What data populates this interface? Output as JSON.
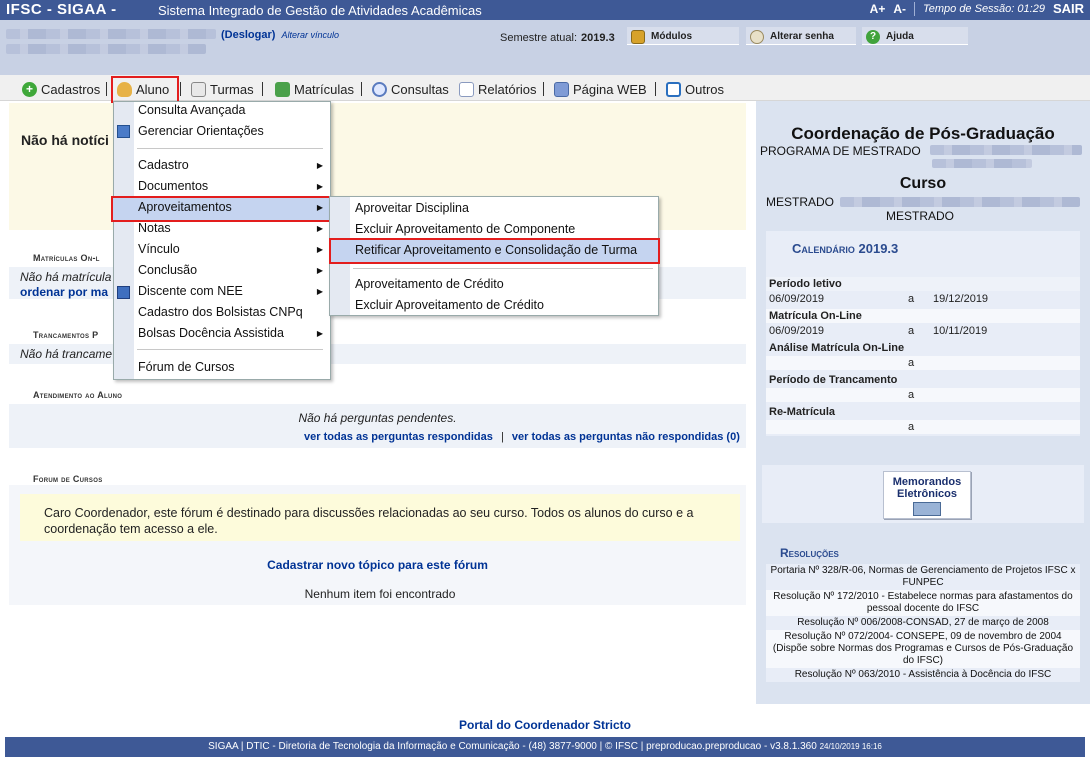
{
  "topbar": {
    "brand": "IFSC - SIGAA -",
    "subtitle": "Sistema Integrado de Gestão de Atividades Acadêmicas",
    "font_increase": "A+",
    "font_decrease": "A-",
    "session": "Tempo de Sessão: 01:29",
    "logout": "SAIR"
  },
  "infobar": {
    "deslogar": "(Deslogar)",
    "alterar_vinculo": "Alterar vínculo",
    "semester_label": "Semestre atual:",
    "semester_value": "2019.3",
    "modules": "Módulos",
    "change_password": "Alterar senha",
    "help": "Ajuda"
  },
  "menubar": {
    "items": [
      "Cadastros",
      "Aluno",
      "Turmas",
      "Matrículas",
      "Consultas",
      "Relatórios",
      "Página WEB",
      "Outros"
    ]
  },
  "aluno_menu": {
    "items": [
      "Consulta Avançada",
      "Gerenciar Orientações",
      "Cadastro",
      "Documentos",
      "Aproveitamentos",
      "Notas",
      "Vínculo",
      "Conclusão",
      "Discente com NEE",
      "Cadastro dos Bolsistas CNPq",
      "Bolsas Docência Assistida",
      "Fórum de Cursos"
    ]
  },
  "aproveitamentos_menu": {
    "items": [
      "Aproveitar Disciplina",
      "Excluir Aproveitamento de Componente",
      "Retificar Aproveitamento e Consolidação de Turma",
      "Aproveitamento de Crédito",
      "Excluir Aproveitamento de Crédito"
    ]
  },
  "main": {
    "noticias": "Não há notíci",
    "matriculas_head": "Matrículas On-l",
    "matriculas_text": "Não há matrícula",
    "matriculas_link": "ordenar por ma",
    "trancamentos_head": "Trancamentos P",
    "trancamentos_text": "Não há trancame",
    "atendimento_head": "Atendimento ao Aluno",
    "atendimento_text": "Não há perguntas pendentes.",
    "link_respondidas": "ver todas as perguntas respondidas",
    "link_separator": "|",
    "link_nao_respondidas": "ver todas as perguntas não respondidas (0)",
    "forum_head": "Forum de Cursos",
    "forum_text": "Caro Coordenador, este fórum é destinado para discussões relacionadas ao seu curso. Todos os alunos do curso e a coordenação tem acesso a ele.",
    "forum_new_topic": "Cadastrar novo tópico para este fórum",
    "forum_empty": "Nenhum item foi encontrado"
  },
  "sidebar": {
    "coord_title": "Coordenação de Pós-Graduação",
    "program_label": "PROGRAMA DE MESTRADO",
    "curso_title": "Curso",
    "mestrado_label": "MESTRADO",
    "mestrado_sub": "MESTRADO",
    "calendar_title": "Calendário 2019.3",
    "calendar": [
      {
        "label": "Período letivo",
        "start": "06/09/2019",
        "sep": "a",
        "end": "19/12/2019"
      },
      {
        "label": "Matrícula On-Line",
        "start": "06/09/2019",
        "sep": "a",
        "end": "10/11/2019"
      },
      {
        "label": "Análise Matrícula On-Line",
        "start": "",
        "sep": "a",
        "end": ""
      },
      {
        "label": "Período de Trancamento",
        "start": "",
        "sep": "a",
        "end": ""
      },
      {
        "label": "Re-Matrícula",
        "start": "",
        "sep": "a",
        "end": ""
      }
    ],
    "memo_line1": "Memorandos",
    "memo_line2": "Eletrônicos",
    "resolucoes_title": "Resoluções",
    "resolucoes": [
      "Portaria Nº 328/R-06, Normas de Gerenciamento de Projetos IFSC x FUNPEC",
      "Resolução Nº 172/2010 - Estabelece normas para afastamentos do pessoal docente do IFSC",
      "Resolução Nº 006/2008-CONSAD, 27 de março de 2008",
      "Resolução Nº 072/2004- CONSEPE, 09 de novembro de 2004 (Dispõe sobre Normas dos Programas e Cursos de Pós-Graduação do IFSC)",
      "Resolução Nº 063/2010 - Assistência à Docência do IFSC"
    ]
  },
  "footer": {
    "portal": "Portal do Coordenador Stricto",
    "text": "SIGAA | DTIC - Diretoria de Tecnologia da Informação e Comunicação - (48) 3877-9000 | © IFSC | preproducao.preproducao - v3.8.1.360",
    "timestamp": "24/10/2019 16:16"
  }
}
